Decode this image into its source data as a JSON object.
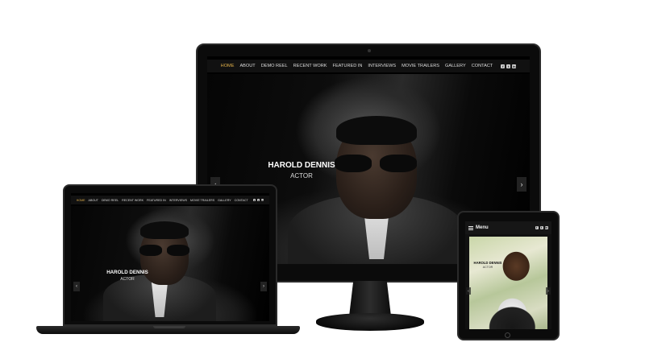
{
  "site": {
    "nav_items": [
      "HOME",
      "ABOUT",
      "DEMO REEL",
      "RECENT WORK",
      "FEATURED IN",
      "INTERVIEWS",
      "MOVIE TRAILERS",
      "GALLERY",
      "CONTACT"
    ],
    "active_nav": "HOME",
    "social": [
      "facebook-icon",
      "twitter-icon",
      "linkedin-icon"
    ],
    "hero": {
      "name": "HAROLD DENNIS",
      "role": "ACTOR"
    },
    "arrows": {
      "prev": "‹",
      "next": "›"
    },
    "colors": {
      "accent": "#e0b04a",
      "nav_bg": "#111111",
      "device": "#0b0b0b"
    }
  },
  "tablet": {
    "menu_label": "Menu"
  }
}
